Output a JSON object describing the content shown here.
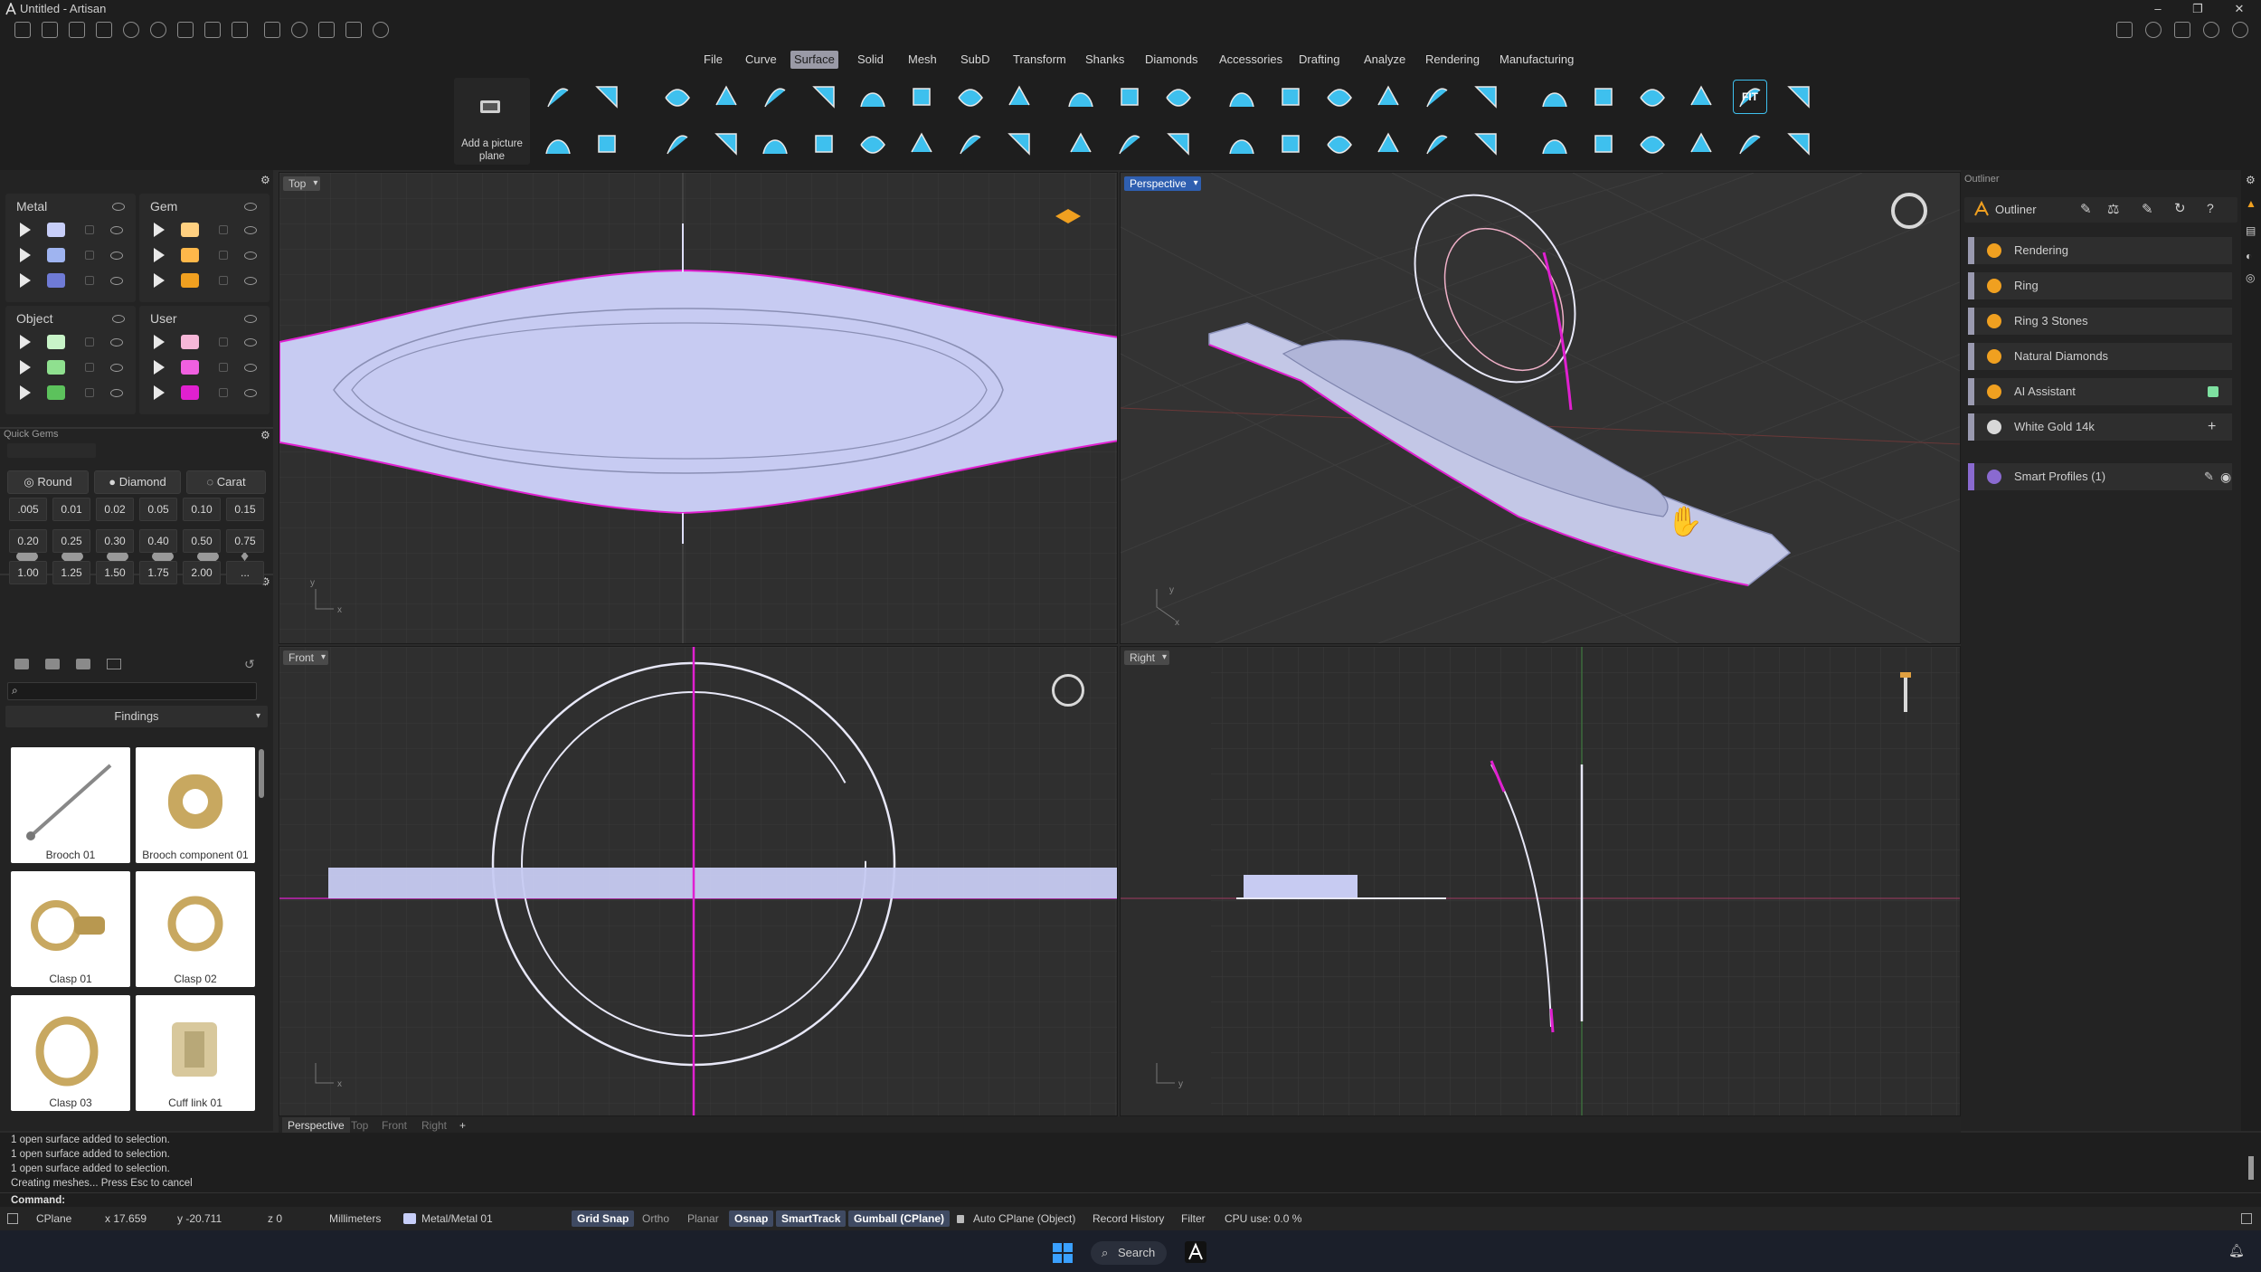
{
  "app": {
    "title": "Untitled - Artisan"
  },
  "menu": [
    "File",
    "Curve",
    "Surface",
    "Solid",
    "Mesh",
    "SubD",
    "Transform",
    "Shanks",
    "Diamonds",
    "Accessories",
    "Drafting",
    "Analyze",
    "Rendering",
    "Manufacturing"
  ],
  "menu_active": "Surface",
  "toolbar": {
    "picture_plane_label": "Add a picture plane",
    "fit_label": "FIT"
  },
  "layers": {
    "metal_title": "Metal",
    "gem_title": "Gem",
    "object_title": "Object",
    "user_title": "User",
    "metal_colors": [
      "#c7cef8",
      "#9fb4f0",
      "#6f7bd6"
    ],
    "gem_colors": [
      "#ffd080",
      "#ffb84a",
      "#f0a020"
    ],
    "object_colors": [
      "#c8f4c8",
      "#8fe08f",
      "#5cc25c"
    ],
    "user_colors": [
      "#f6b7d8",
      "#f060e0",
      "#e020d0"
    ]
  },
  "quick_gems": {
    "title": "Quick Gems",
    "shape_label": "Round",
    "type_label": "Diamond",
    "unit_label": "Carat",
    "sizes": [
      ".005",
      "0.01",
      "0.02",
      "0.05",
      "0.10",
      "0.15",
      "0.20",
      "0.25",
      "0.30",
      "0.40",
      "0.50",
      "0.75",
      "1.00",
      "1.25",
      "1.50",
      "1.75",
      "2.00",
      "..."
    ]
  },
  "library": {
    "category": "Findings",
    "items": [
      "Brooch 01",
      "Brooch component 01",
      "Clasp 01",
      "Clasp 02",
      "Clasp 03",
      "Cuff link 01"
    ]
  },
  "viewports": {
    "top": "Top",
    "perspective": "Perspective",
    "front": "Front",
    "right": "Right"
  },
  "viewport_tabs": [
    "Perspective",
    "Top",
    "Front",
    "Right",
    "+"
  ],
  "outliner": {
    "title": "Outliner",
    "header": "Outliner",
    "items": [
      "Rendering",
      "Ring",
      "Ring 3 Stones",
      "Natural Diamonds",
      "AI Assistant",
      "White Gold 14k"
    ],
    "smart_profiles": "Smart Profiles (1)"
  },
  "command_history": [
    "1 open surface added to selection.",
    "1 open surface added to selection.",
    "1 open surface added to selection.",
    "Creating meshes... Press Esc to cancel"
  ],
  "command_prompt": "Command:",
  "status": {
    "cplane": "CPlane",
    "x": "x 17.659",
    "y": "y -20.711",
    "z": "z 0",
    "units": "Millimeters",
    "layer": "Metal/Metal 01",
    "grid_snap": "Grid Snap",
    "ortho": "Ortho",
    "planar": "Planar",
    "osnap": "Osnap",
    "smarttrack": "SmartTrack",
    "gumball": "Gumball (CPlane)",
    "auto_cplane": "Auto CPlane (Object)",
    "record_history": "Record History",
    "filter": "Filter",
    "cpu": "CPU use: 0.0 %"
  },
  "taskbar": {
    "search": "Search"
  },
  "colors": {
    "accent": "#4fc3e8",
    "selection": "#e020d0",
    "active_view": "#2f5fb0"
  }
}
